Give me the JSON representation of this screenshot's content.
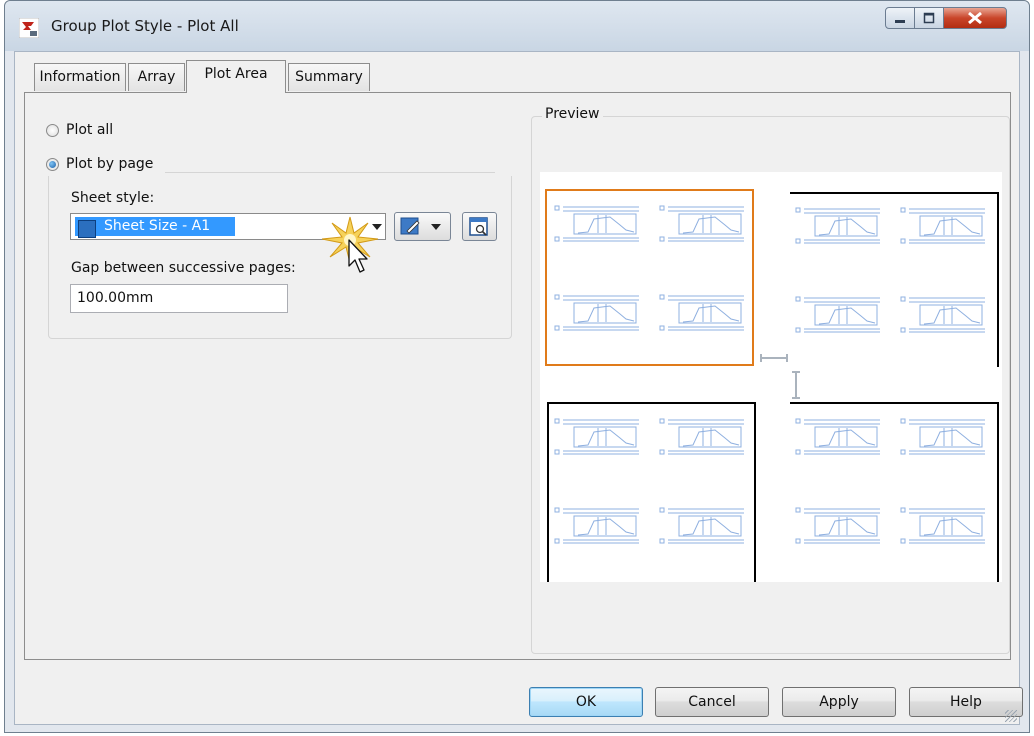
{
  "window": {
    "title": "Group Plot Style - Plot All",
    "accent_color": "#e07b1a",
    "selection_color": "#3399ff"
  },
  "tabs": [
    {
      "label": "Information",
      "active": false
    },
    {
      "label": "Array",
      "active": false
    },
    {
      "label": "Plot Area",
      "active": true
    },
    {
      "label": "Summary",
      "active": false
    }
  ],
  "plot_area": {
    "plot_all_label": "Plot all",
    "plot_all_checked": false,
    "plot_by_page_label": "Plot by page",
    "plot_by_page_checked": true,
    "sheet_style_label": "Sheet style:",
    "sheet_style_value": "Sheet Size - A1",
    "gap_label": "Gap between successive pages:",
    "gap_value": "100.00mm"
  },
  "preview": {
    "label": "Preview",
    "pages": [
      {
        "position": "top-left",
        "selected": true
      },
      {
        "position": "top-right",
        "selected": false
      },
      {
        "position": "bottom-left",
        "selected": false
      },
      {
        "position": "bottom-right",
        "selected": false
      }
    ]
  },
  "buttons": {
    "ok": "OK",
    "cancel": "Cancel",
    "apply": "Apply",
    "help": "Help"
  },
  "icons": [
    "app-icon",
    "minimize-icon",
    "maximize-icon",
    "close-icon",
    "sheet-style-icon",
    "dropdown-arrow-icon",
    "edit-style-icon",
    "preview-magnifier-icon",
    "mouse-cursor-icon",
    "click-burst-icon",
    "resize-grip-icon"
  ]
}
